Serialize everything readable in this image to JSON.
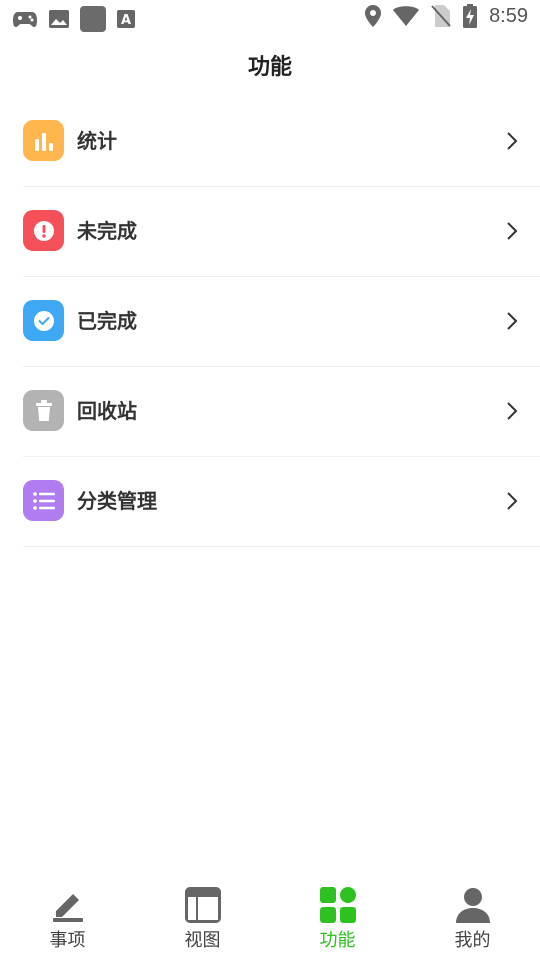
{
  "status_bar": {
    "time": "8:59",
    "left_icons": [
      "gamepad-icon",
      "image-icon",
      "app-square-icon",
      "font-a-icon"
    ],
    "right_icons": [
      "location-icon",
      "wifi-icon",
      "no-sim-icon",
      "battery-charging-icon"
    ]
  },
  "header": {
    "title": "功能"
  },
  "menu": [
    {
      "label": "统计",
      "icon": "bar-chart-icon",
      "color": "#ffb74d"
    },
    {
      "label": "未完成",
      "icon": "exclamation-circle-icon",
      "color": "#f4505a"
    },
    {
      "label": "已完成",
      "icon": "check-circle-icon",
      "color": "#3ea8f5"
    },
    {
      "label": "回收站",
      "icon": "trash-icon",
      "color": "#b3b3b3"
    },
    {
      "label": "分类管理",
      "icon": "list-icon",
      "color": "#b07cf0"
    }
  ],
  "bottom_nav": [
    {
      "label": "事项",
      "icon": "pencil-icon",
      "active": false
    },
    {
      "label": "视图",
      "icon": "layout-icon",
      "active": false
    },
    {
      "label": "功能",
      "icon": "grid-icon",
      "active": true
    },
    {
      "label": "我的",
      "icon": "user-icon",
      "active": false
    }
  ],
  "colors": {
    "accent": "#2dc21f",
    "inactive_icon": "#666666"
  }
}
